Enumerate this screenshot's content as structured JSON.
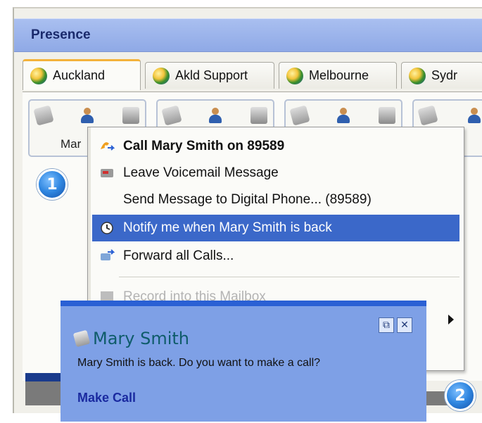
{
  "window": {
    "title": "Presence",
    "tabs": [
      {
        "label": "Auckland",
        "active": true
      },
      {
        "label": "Akld Support",
        "active": false
      },
      {
        "label": "Melbourne",
        "active": false
      },
      {
        "label": "Sydr",
        "active": false
      }
    ],
    "contacts": [
      {
        "name": "Mar",
        "status_icon": "clock-icon"
      },
      {
        "name": "",
        "status_icon": "none"
      },
      {
        "name": "",
        "status_icon": "star-icon"
      },
      {
        "name": "",
        "status_icon": "none"
      }
    ]
  },
  "context_menu": {
    "items": [
      {
        "label": "Call Mary Smith on 89589",
        "icon": "call-icon",
        "bold": true
      },
      {
        "label": "Leave Voicemail Message",
        "icon": "voicemail-icon"
      },
      {
        "label": "Send Message to Digital Phone... (89589)",
        "icon": ""
      },
      {
        "label": "Notify me when Mary Smith is back",
        "icon": "clock-icon",
        "selected": true
      },
      {
        "label": "Forward all Calls...",
        "icon": "forward-icon"
      },
      {
        "label": "Record into this Mailbox",
        "icon": "mailbox-icon",
        "disabled": true
      }
    ]
  },
  "notification": {
    "sender": "Mary Smith",
    "message": "Mary Smith is back. Do you want to make a call?",
    "action": "Make Call"
  },
  "callouts": [
    "1",
    "2"
  ],
  "colors": {
    "selection": "#3b68c9",
    "titlebar": "#8fa9e6",
    "toast": "#7ea0e6",
    "tab_accent": "#f3b23b"
  }
}
